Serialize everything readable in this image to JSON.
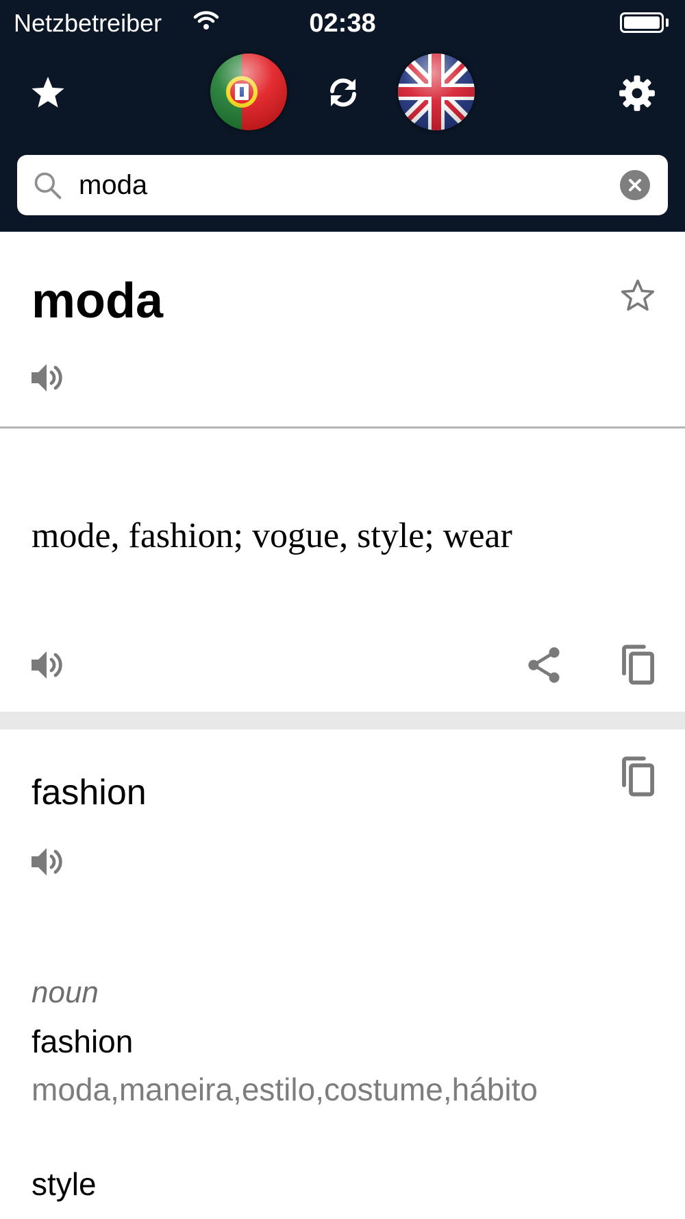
{
  "status_bar": {
    "carrier": "Netzbetreiber",
    "time": "02:38"
  },
  "toolbar": {
    "favorites_icon": "star-icon",
    "source_language_icon": "portugal-flag-icon",
    "swap_icon": "swap-refresh-icon",
    "target_language_icon": "uk-flag-icon",
    "settings_icon": "gear-icon"
  },
  "search": {
    "value": "moda",
    "placeholder": ""
  },
  "entry": {
    "term": "moda",
    "translation": "mode, fashion; vogue, style; wear"
  },
  "dictionary": {
    "headword": "fashion",
    "part_of_speech": "noun",
    "senses": [
      {
        "word": "fashion",
        "synonyms": "moda,maneira,estilo,costume,hábito"
      },
      {
        "word": "style",
        "synonyms": ""
      }
    ]
  },
  "colors": {
    "header_bg": "#0b1726",
    "icon_gray": "#7a7a7a",
    "divider": "#b5b5b5",
    "section_gap": "#e8e8e8"
  }
}
